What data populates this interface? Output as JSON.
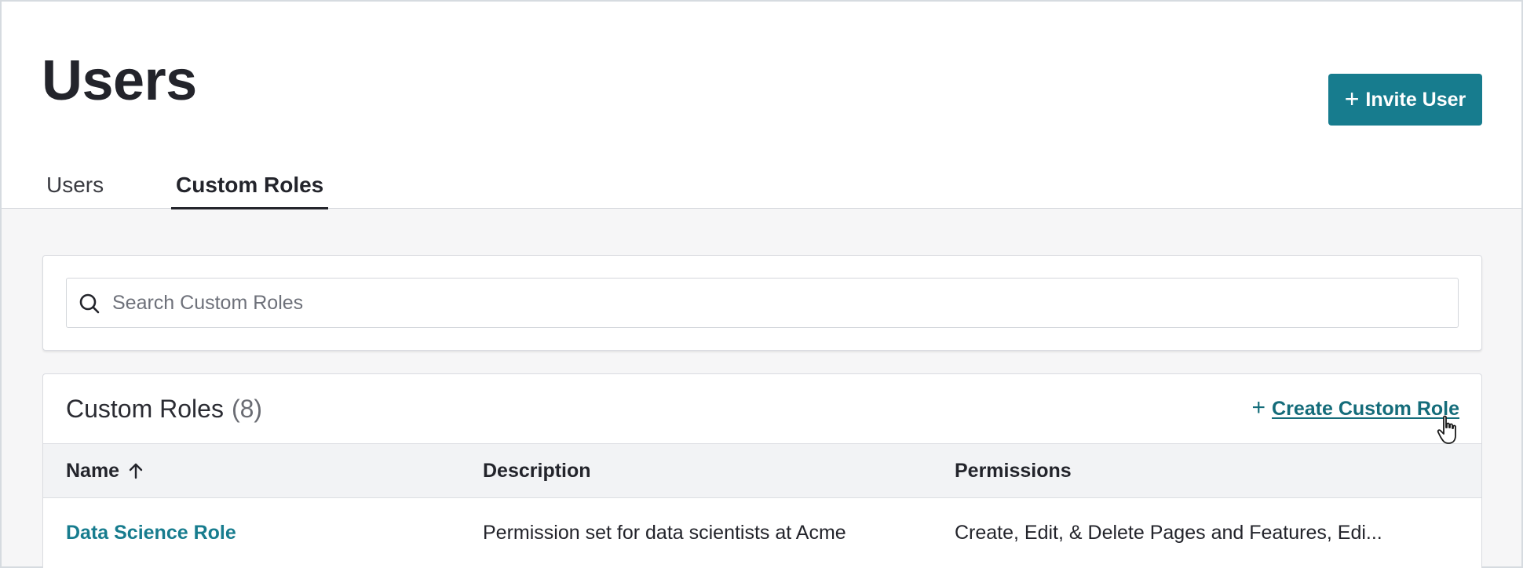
{
  "header": {
    "title": "Users",
    "invite_button": {
      "icon": "plus-icon",
      "label": "Invite User"
    }
  },
  "tabs": [
    {
      "label": "Users",
      "active": false
    },
    {
      "label": "Custom Roles",
      "active": true
    }
  ],
  "search": {
    "placeholder": "Search Custom Roles",
    "value": "",
    "icon": "search-icon"
  },
  "roles": {
    "title": "Custom Roles",
    "count": "(8)",
    "create_link": {
      "icon": "plus-icon",
      "label": "Create Custom Role"
    },
    "columns": [
      {
        "label": "Name",
        "sort": "ascending",
        "sort_icon": "arrow-up-icon"
      },
      {
        "label": "Description"
      },
      {
        "label": "Permissions"
      }
    ],
    "rows": [
      {
        "name": "Data Science Role",
        "description": "Permission set for data scientists at Acme",
        "permissions": "Create, Edit, & Delete Pages and Features, Edi..."
      }
    ]
  },
  "colors": {
    "accent": "#177c8e",
    "link": "#146c7a",
    "text": "#23242b",
    "background": "#f6f6f7"
  }
}
